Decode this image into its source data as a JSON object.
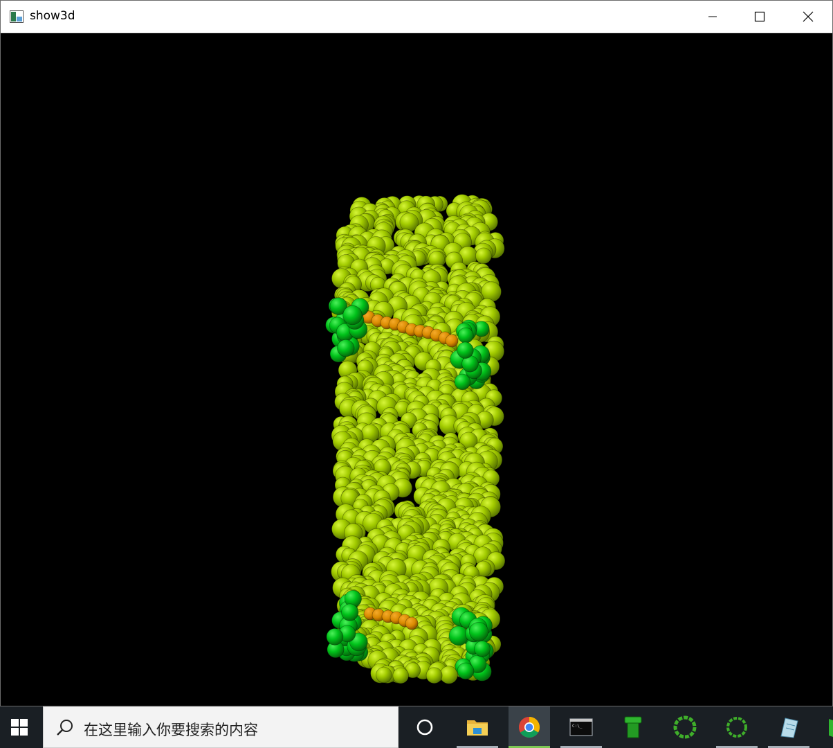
{
  "window": {
    "title": "show3d",
    "controls": {
      "minimize": "minimize",
      "maximize": "maximize",
      "close": "close"
    }
  },
  "scene": {
    "background_color": "#000000",
    "body_color": "#98c400",
    "body_highlight_color": "#c8ef2a",
    "body_shadow_color": "#6e8f00",
    "marker_color": "#00c21a",
    "marker_shadow_color": "#0a8a12",
    "band_color": "#d98a00"
  },
  "taskbar": {
    "start_icon": "windows-start-icon",
    "search": {
      "icon": "search-icon",
      "placeholder": "在这里输入你要搜索的内容"
    },
    "items": [
      {
        "icon": "cortana-icon",
        "running": false
      },
      {
        "icon": "file-explorer-icon",
        "running": true
      },
      {
        "icon": "chrome-icon",
        "running": true,
        "active": true
      },
      {
        "icon": "console-icon",
        "running": true
      },
      {
        "icon": "green-pipe-icon",
        "running": false
      },
      {
        "icon": "green-ring-icon",
        "running": false
      },
      {
        "icon": "green-ring-icon",
        "running": true
      },
      {
        "icon": "notes-icon",
        "running": true
      },
      {
        "icon": "green-app-icon",
        "running": false
      }
    ]
  }
}
